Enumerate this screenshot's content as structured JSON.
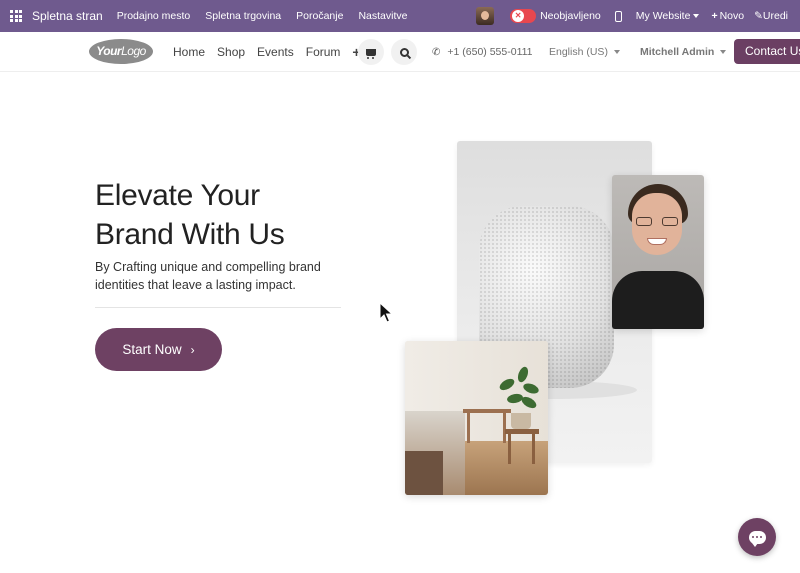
{
  "admin_bar": {
    "app_name": "Spletna stran",
    "menu": [
      "Prodajno mesto",
      "Spletna trgovina",
      "Poročanje",
      "Nastavitve"
    ],
    "publish_status": "Neobjavljeno",
    "website_selector": "My Website",
    "new_label": "Novo",
    "edit_label": "Uredi",
    "accent_color": "#6f5a8e"
  },
  "site_header": {
    "logo_text_bold": "Your",
    "logo_text": "Logo",
    "nav": [
      "Home",
      "Shop",
      "Events",
      "Forum"
    ],
    "phone": "+1 (650) 555-0111",
    "language": "English (US)",
    "user": "Mitchell Admin",
    "contact_label": "Contact Us"
  },
  "hero": {
    "title_line1": "Elevate Your",
    "title_line2": "Brand With Us",
    "subtitle": "By Crafting unique and compelling brand identities that leave a lasting impact.",
    "cta_label": "Start Now",
    "brand_color": "#6e4163"
  },
  "icons": {
    "cart": "cart-icon",
    "search": "search-icon",
    "phone": "phone-icon",
    "chat": "chat-icon",
    "plus": "plus-icon"
  }
}
